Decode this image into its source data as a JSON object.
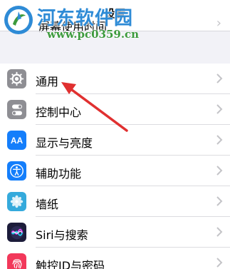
{
  "header": {
    "title": "设置",
    "partial_row_label": "屏幕使用时间"
  },
  "watermark": {
    "title": "河东软件园",
    "url": "www.pc0359.cn"
  },
  "settings": {
    "items": [
      {
        "label": "通用",
        "icon": "gear-icon",
        "color": "#8e8e93"
      },
      {
        "label": "控制中心",
        "icon": "toggles-icon",
        "color": "#8e8e93"
      },
      {
        "label": "显示与亮度",
        "icon": "aa-icon",
        "color": "#147efb",
        "icon_text": "AA"
      },
      {
        "label": "辅助功能",
        "icon": "accessibility-icon",
        "color": "#147efb"
      },
      {
        "label": "墙纸",
        "icon": "wallpaper-flower-icon",
        "color": "#35aadc"
      },
      {
        "label": "Siri与搜索",
        "icon": "siri-icon",
        "color": "#1c1c3a"
      },
      {
        "label": "触控ID与密码",
        "icon": "fingerprint-icon",
        "color": "#f2385a"
      }
    ]
  },
  "annotation": {
    "color": "#e03030"
  }
}
